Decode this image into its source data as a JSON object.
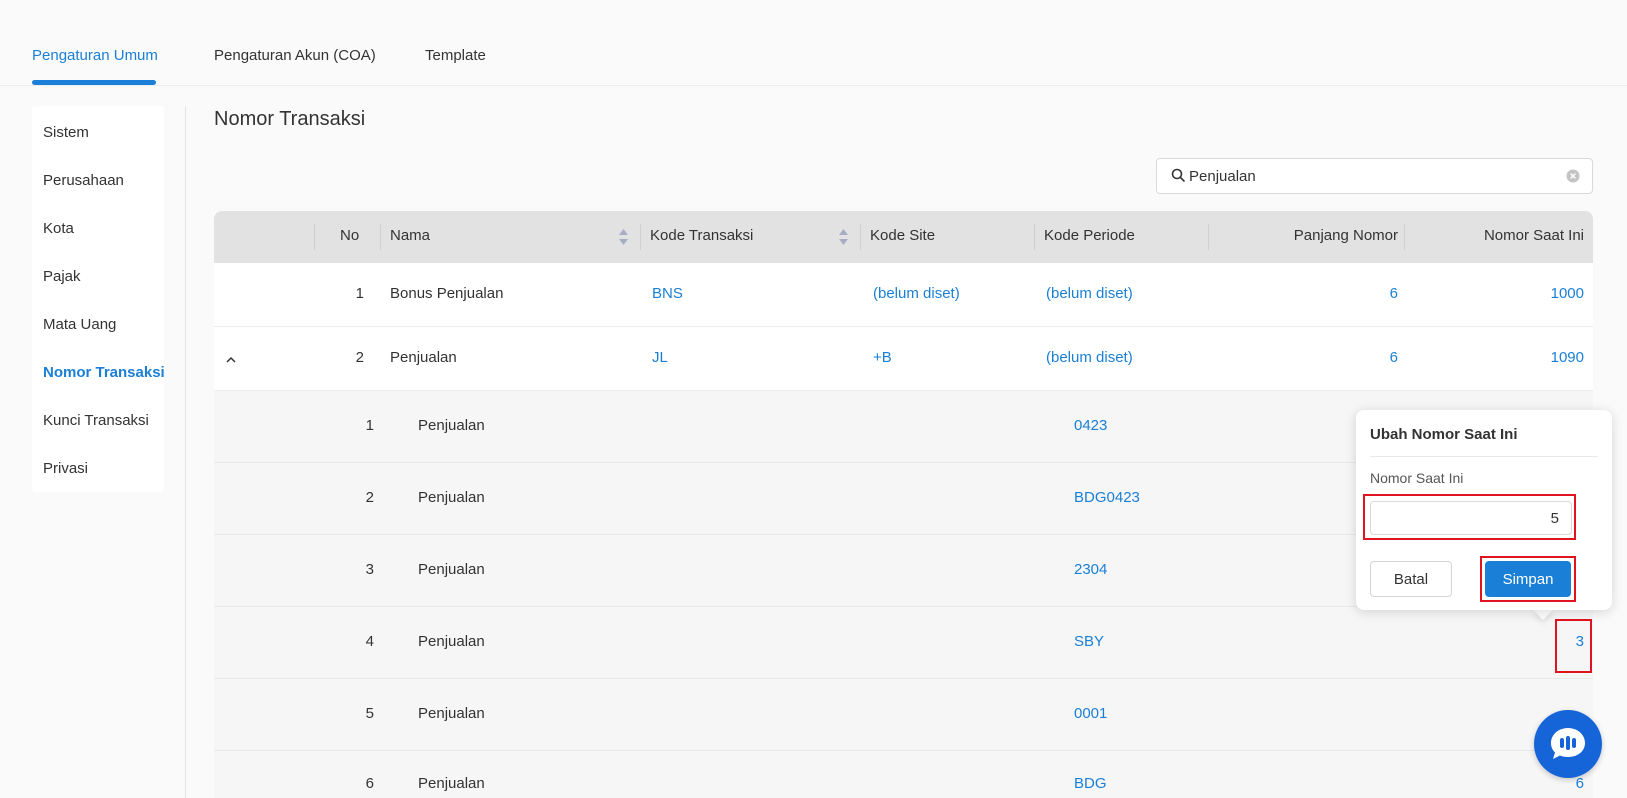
{
  "tabs": [
    {
      "label": "Pengaturan Umum",
      "active": true
    },
    {
      "label": "Pengaturan Akun (COA)",
      "active": false
    },
    {
      "label": "Template",
      "active": false
    }
  ],
  "sidebar": {
    "items": [
      {
        "label": "Sistem"
      },
      {
        "label": "Perusahaan"
      },
      {
        "label": "Kota"
      },
      {
        "label": "Pajak"
      },
      {
        "label": "Mata Uang"
      },
      {
        "label": "Nomor Transaksi",
        "active": true
      },
      {
        "label": "Kunci Transaksi"
      },
      {
        "label": "Privasi"
      }
    ]
  },
  "page": {
    "title": "Nomor Transaksi"
  },
  "search": {
    "value": "Penjualan"
  },
  "table": {
    "headers": {
      "no": "No",
      "nama": "Nama",
      "kode_transaksi": "Kode Transaksi",
      "kode_site": "Kode Site",
      "kode_periode": "Kode Periode",
      "panjang_nomor": "Panjang Nomor",
      "nomor_saat_ini": "Nomor Saat Ini"
    },
    "rows": [
      {
        "no": "1",
        "nama": "Bonus Penjualan",
        "kode_transaksi": "BNS",
        "kode_site": "(belum diset)",
        "kode_periode": "(belum diset)",
        "panjang_nomor": "6",
        "nomor_saat_ini": "1000"
      },
      {
        "no": "2",
        "nama": "Penjualan",
        "kode_transaksi": "JL",
        "kode_site": "+B",
        "kode_periode": "(belum diset)",
        "panjang_nomor": "6",
        "nomor_saat_ini": "1090"
      }
    ],
    "sub_rows": [
      {
        "no": "1",
        "nama": "Penjualan",
        "periode": "0423",
        "nomor": ""
      },
      {
        "no": "2",
        "nama": "Penjualan",
        "periode": "BDG0423",
        "nomor": ""
      },
      {
        "no": "3",
        "nama": "Penjualan",
        "periode": "2304",
        "nomor": ""
      },
      {
        "no": "4",
        "nama": "Penjualan",
        "periode": "SBY",
        "nomor": "3"
      },
      {
        "no": "5",
        "nama": "Penjualan",
        "periode": "0001",
        "nomor": ""
      },
      {
        "no": "6",
        "nama": "Penjualan",
        "periode": "BDG",
        "nomor": "6"
      }
    ]
  },
  "popover": {
    "title": "Ubah Nomor Saat Ini",
    "field_label": "Nomor Saat Ini",
    "field_value": "5",
    "cancel_label": "Batal",
    "save_label": "Simpan"
  },
  "colors": {
    "accent": "#1a7fd6",
    "highlight": "#e0141e",
    "chat": "#1565d8"
  },
  "icons": {
    "search": "search-icon",
    "clear": "clear-icon",
    "sort": "sort-icon",
    "collapse": "chevron-up-icon",
    "chat": "chat-icon"
  }
}
